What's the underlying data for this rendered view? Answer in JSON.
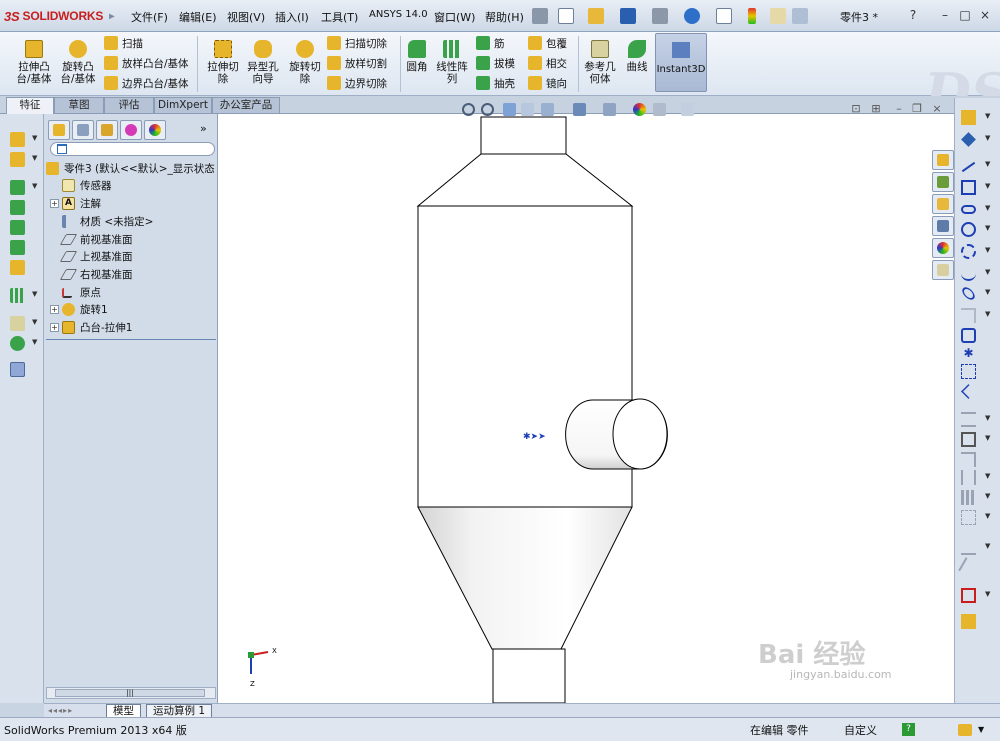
{
  "app": {
    "logo_text": "SOLIDWORKS",
    "document_title": "零件3 *"
  },
  "menu": [
    "文件(F)",
    "编辑(E)",
    "视图(V)",
    "插入(I)",
    "工具(T)",
    "ANSYS 14.0",
    "窗口(W)",
    "帮助(H)"
  ],
  "window_controls": [
    "?",
    "–",
    "□",
    "×"
  ],
  "ribbon": {
    "extrude_boss": "拉伸凸\n台/基体",
    "revolve_boss": "旋转凸\n台/基体",
    "sweep": "扫描",
    "loft": "放样凸台/基体",
    "boundary_boss": "边界凸台/基体",
    "extrude_cut": "拉伸切\n除",
    "hole_wizard": "异型孔\n向导",
    "revolve_cut": "旋转切\n除",
    "swept_cut": "扫描切除",
    "lofted_cut": "放样切割",
    "boundary_cut": "边界切除",
    "fillet": "圆角",
    "linear_pattern": "线性阵\n列",
    "rib": "筋",
    "draft": "拔模",
    "shell": "抽壳",
    "wrap": "包覆",
    "intersect": "相交",
    "mirror": "镜向",
    "ref_geometry": "参考几\n何体",
    "curves": "曲线",
    "instant3d": "Instant3D"
  },
  "tabs": [
    "特征",
    "草图",
    "评估",
    "DimXpert",
    "办公室产品"
  ],
  "feature_tree": {
    "root": "零件3 (默认<<默认>_显示状态",
    "items": [
      "传感器",
      "注解",
      "材质 <未指定>",
      "前视基准面",
      "上视基准面",
      "右视基准面",
      "原点",
      "旋转1",
      "凸台-拉伸1"
    ]
  },
  "model_tabs": [
    "模型",
    "运动算例 1"
  ],
  "status": {
    "product": "SolidWorks Premium 2013 x64 版",
    "mode": "在编辑 零件",
    "units": "自定义"
  },
  "triad": {
    "x": "X",
    "z": "Z"
  },
  "watermark": {
    "brand": "Bai 经验",
    "url": "jingyan.baidu.com"
  },
  "colors": {
    "accent_red": "#c81e1e",
    "ribbon_bg": "#e6edf6",
    "panel_bg": "#d2dce9",
    "selection_blue": "#1d3fb3"
  }
}
